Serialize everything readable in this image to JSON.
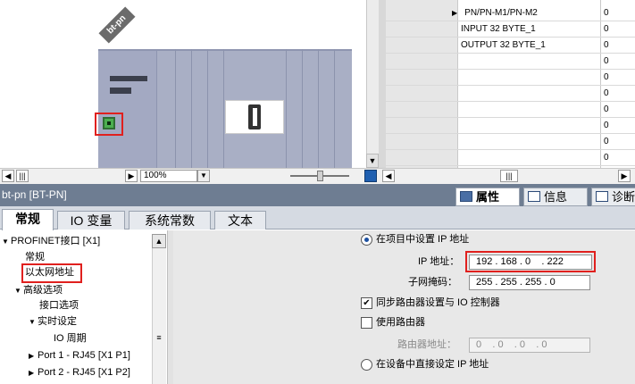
{
  "device_view": {
    "device_label": "bt-pn",
    "zoom": "100%"
  },
  "table": {
    "rows": [
      {
        "label": "PN/PN-M1/PN-M2",
        "value": "0",
        "expander": "▶"
      },
      {
        "label": "INPUT 32 BYTE_1",
        "value": "0"
      },
      {
        "label": "OUTPUT 32 BYTE_1",
        "value": "0"
      },
      {
        "label": "",
        "value": "0"
      },
      {
        "label": "",
        "value": "0"
      },
      {
        "label": "",
        "value": "0"
      },
      {
        "label": "",
        "value": "0"
      },
      {
        "label": "",
        "value": "0"
      },
      {
        "label": "",
        "value": "0"
      },
      {
        "label": "",
        "value": "0"
      }
    ]
  },
  "inspector": {
    "title": "bt-pn [BT-PN]",
    "tabs": {
      "properties": "属性",
      "info": "信息",
      "diagnostics": "诊断"
    },
    "subtabs": {
      "general": "常规",
      "io_vars": "IO 变量",
      "constants": "系统常数",
      "text": "文本"
    }
  },
  "tree": {
    "items": [
      "PROFINET接口 [X1]",
      "常规",
      "以太网地址",
      "高级选项",
      "接口选项",
      "实时设定",
      "IO 周期",
      "Port 1 - RJ45 [X1 P1]",
      "Port 2 - RJ45 [X1 P2]"
    ]
  },
  "ip_settings": {
    "radio_project": "在项目中设置 IP 地址",
    "ip_label": "IP 地址：",
    "ip_value": "192 . 168 . 0    . 222",
    "subnet_label": "子网掩码：",
    "subnet_value": "255 . 255 . 255 . 0",
    "sync_router": "同步路由器设置与 IO 控制器",
    "use_router": "使用路由器",
    "router_label": "路由器地址：",
    "router_value": "0    . 0    . 0    . 0",
    "radio_device": "在设备中直接设定 IP 地址"
  },
  "colors": {
    "highlight": "#e0201e",
    "title_bar": "#6e7d92",
    "rack": "#a9afc5"
  }
}
